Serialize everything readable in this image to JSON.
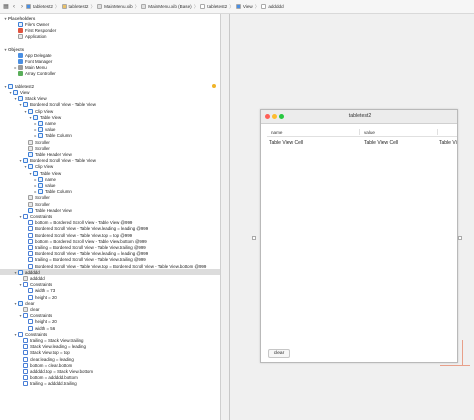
{
  "jumpbar": {
    "crumbs": [
      {
        "label": "tabletest2",
        "color": "#4a8fe3"
      },
      {
        "label": "tabletest2",
        "color": "#e8c16a"
      },
      {
        "label": "MainMenu.xib",
        "color": "#e0e0e0"
      },
      {
        "label": "MainMenu.xib (Base)",
        "color": "#e0e0e0"
      },
      {
        "label": "tabletest2",
        "color": "#ffffff"
      },
      {
        "label": "View",
        "color": "#4a8fe3"
      },
      {
        "label": "addddd",
        "color": "#ffffff"
      }
    ],
    "separator": "〉"
  },
  "outline": {
    "rows": [
      {
        "label": "Placeholders",
        "indent": 0,
        "icon": "none",
        "disc": "open",
        "section": true
      },
      {
        "label": "File's Owner",
        "indent": 2,
        "icon": "outlineblue",
        "disc": ""
      },
      {
        "label": "First Responder",
        "indent": 2,
        "icon": "red",
        "disc": ""
      },
      {
        "label": "Application",
        "indent": 2,
        "icon": "doc",
        "disc": ""
      },
      {
        "label": "",
        "indent": 0,
        "icon": "none",
        "disc": ""
      },
      {
        "label": "Objects",
        "indent": 0,
        "icon": "none",
        "disc": "open",
        "section": true
      },
      {
        "label": "App Delegate",
        "indent": 2,
        "icon": "cube",
        "disc": ""
      },
      {
        "label": "Font Manager",
        "indent": 2,
        "icon": "cube",
        "disc": ""
      },
      {
        "label": "Main Menu",
        "indent": 2,
        "icon": "gray",
        "disc": "closed"
      },
      {
        "label": "Array Controller",
        "indent": 2,
        "icon": "green",
        "disc": ""
      },
      {
        "label": "",
        "indent": 0,
        "icon": "none",
        "disc": ""
      },
      {
        "label": "tabletest2",
        "indent": 0,
        "icon": "outlineblue",
        "disc": "open",
        "warn": true
      },
      {
        "label": "View",
        "indent": 1,
        "icon": "outlineblue",
        "disc": "open"
      },
      {
        "label": "Stack View",
        "indent": 2,
        "icon": "outlineblue",
        "disc": "open"
      },
      {
        "label": "Bordered Scroll View - Table View",
        "indent": 3,
        "icon": "outlineblue",
        "disc": "open"
      },
      {
        "label": "Clip View",
        "indent": 4,
        "icon": "outlineblue",
        "disc": "open"
      },
      {
        "label": "Table View",
        "indent": 5,
        "icon": "outlineblue",
        "disc": "open"
      },
      {
        "label": "name",
        "indent": 6,
        "icon": "outlineblue",
        "disc": "closed"
      },
      {
        "label": "value",
        "indent": 6,
        "icon": "outlineblue",
        "disc": "closed"
      },
      {
        "label": "Table Column",
        "indent": 6,
        "icon": "outlineblue",
        "disc": "closed"
      },
      {
        "label": "Scroller",
        "indent": 4,
        "icon": "doc",
        "disc": ""
      },
      {
        "label": "Scroller",
        "indent": 4,
        "icon": "doc",
        "disc": ""
      },
      {
        "label": "Table Header View",
        "indent": 4,
        "icon": "outlineblue",
        "disc": ""
      },
      {
        "label": "Bordered Scroll View - Table View",
        "indent": 3,
        "icon": "outlineblue",
        "disc": "open"
      },
      {
        "label": "Clip View",
        "indent": 4,
        "icon": "outlineblue",
        "disc": "open"
      },
      {
        "label": "Table View",
        "indent": 5,
        "icon": "outlineblue",
        "disc": "open"
      },
      {
        "label": "name",
        "indent": 6,
        "icon": "outlineblue",
        "disc": "closed"
      },
      {
        "label": "value",
        "indent": 6,
        "icon": "outlineblue",
        "disc": "closed"
      },
      {
        "label": "Table Column",
        "indent": 6,
        "icon": "outlineblue",
        "disc": "closed"
      },
      {
        "label": "Scroller",
        "indent": 4,
        "icon": "doc",
        "disc": ""
      },
      {
        "label": "Scroller",
        "indent": 4,
        "icon": "doc",
        "disc": ""
      },
      {
        "label": "Table Header View",
        "indent": 4,
        "icon": "outlineblue",
        "disc": ""
      },
      {
        "label": "Constraints",
        "indent": 3,
        "icon": "constraint",
        "disc": "open"
      },
      {
        "label": "bottom = Bordered Scroll View - Table View @999",
        "indent": 4,
        "icon": "constraint",
        "disc": ""
      },
      {
        "label": "Bordered Scroll View - Table View.leading = leading @999",
        "indent": 4,
        "icon": "constraint",
        "disc": ""
      },
      {
        "label": "Bordered Scroll View - Table View.top = top @999",
        "indent": 4,
        "icon": "constraint",
        "disc": ""
      },
      {
        "label": "bottom = Bordered Scroll View - Table View.bottom @999",
        "indent": 4,
        "icon": "constraint",
        "disc": ""
      },
      {
        "label": "trailing = Bordered Scroll View - Table View.trailing @999",
        "indent": 4,
        "icon": "constraint",
        "disc": ""
      },
      {
        "label": "Bordered Scroll View - Table View.leading = leading @999",
        "indent": 4,
        "icon": "constraint",
        "disc": ""
      },
      {
        "label": "trailing = Bordered Scroll View - Table View.trailing @999",
        "indent": 4,
        "icon": "constraint",
        "disc": ""
      },
      {
        "label": "Bordered Scroll View - Table View.top = Bordered Scroll View - Table View.bottom @999",
        "indent": 4,
        "icon": "constraint",
        "disc": ""
      },
      {
        "label": "addddd",
        "indent": 2,
        "icon": "outlineblue",
        "disc": "open",
        "selected": true
      },
      {
        "label": "addddd",
        "indent": 3,
        "icon": "doc",
        "disc": ""
      },
      {
        "label": "Constraints",
        "indent": 3,
        "icon": "constraint",
        "disc": "open"
      },
      {
        "label": "width = 73",
        "indent": 4,
        "icon": "constraint",
        "disc": ""
      },
      {
        "label": "height = 20",
        "indent": 4,
        "icon": "constraint",
        "disc": ""
      },
      {
        "label": "clear",
        "indent": 2,
        "icon": "outlineblue",
        "disc": "open"
      },
      {
        "label": "clear",
        "indent": 3,
        "icon": "doc",
        "disc": ""
      },
      {
        "label": "Constraints",
        "indent": 3,
        "icon": "constraint",
        "disc": "open"
      },
      {
        "label": "height = 20",
        "indent": 4,
        "icon": "constraint",
        "disc": ""
      },
      {
        "label": "width = 56",
        "indent": 4,
        "icon": "constraint",
        "disc": ""
      },
      {
        "label": "Constraints",
        "indent": 2,
        "icon": "constraint",
        "disc": "open"
      },
      {
        "label": "trailing = Stack View.trailing",
        "indent": 3,
        "icon": "constraint",
        "disc": ""
      },
      {
        "label": "Stack View.leading = leading",
        "indent": 3,
        "icon": "constraint",
        "disc": ""
      },
      {
        "label": "Stack View.top = top",
        "indent": 3,
        "icon": "constraint",
        "disc": ""
      },
      {
        "label": "clear.leading = leading",
        "indent": 3,
        "icon": "constraint",
        "disc": ""
      },
      {
        "label": "bottom = clear.bottom",
        "indent": 3,
        "icon": "constraint",
        "disc": ""
      },
      {
        "label": "addddd.top = Stack View.bottom",
        "indent": 3,
        "icon": "constraint",
        "disc": ""
      },
      {
        "label": "bottom = addddd.bottom",
        "indent": 3,
        "icon": "constraint",
        "disc": ""
      },
      {
        "label": "trailing = addddd.trailing",
        "indent": 3,
        "icon": "constraint",
        "disc": ""
      }
    ]
  },
  "window": {
    "title": "tabletest2",
    "table": {
      "headers": [
        "name",
        "value"
      ],
      "cells": [
        "Table View Cell",
        "Table View Cell",
        "Table View"
      ]
    },
    "clear_label": "clear"
  },
  "colors": {
    "accent": "#4a8fe3",
    "selection": "#dcdcdc",
    "guide": "#e8a08a"
  }
}
